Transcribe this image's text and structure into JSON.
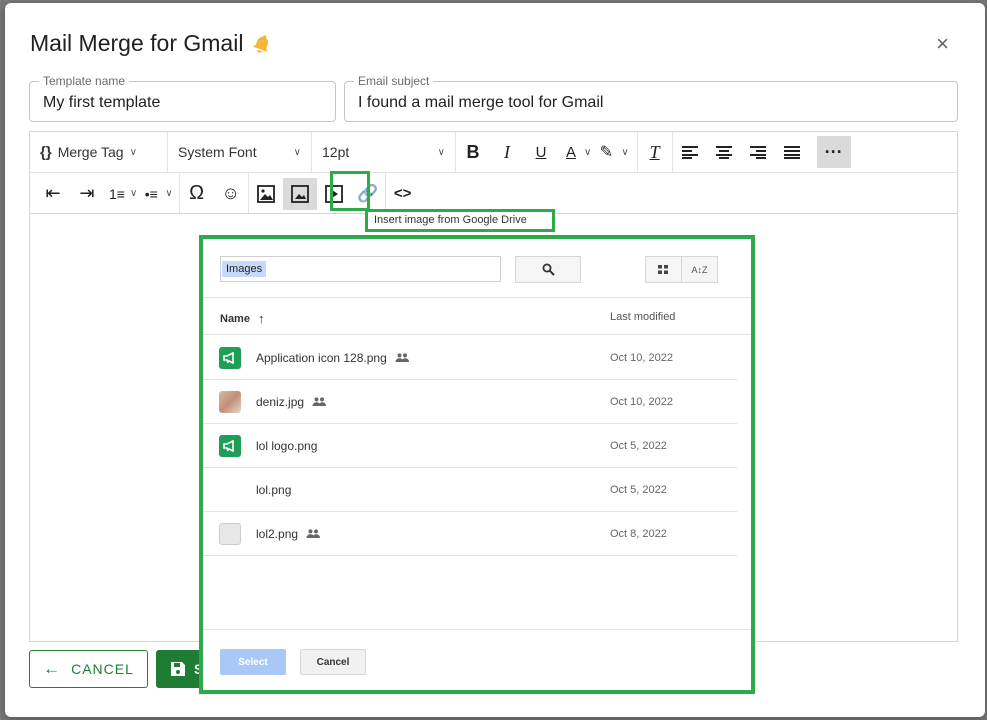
{
  "dialog": {
    "title": "Mail Merge for Gmail",
    "close_symbol": "×"
  },
  "template_name": {
    "label": "Template name",
    "value": "My first template"
  },
  "email_subject": {
    "label": "Email subject",
    "value": "I found a mail merge tool for Gmail"
  },
  "toolbar": {
    "merge_tag_label": "Merge Tag",
    "font_label": "System Font",
    "size_label": "12pt",
    "tooltip": "Insert image from Google Drive",
    "icons": [
      "merge-tag-icon",
      "bold-icon",
      "italic-icon",
      "underline-icon",
      "text-color-icon",
      "highlight-icon",
      "clear-formatting-icon",
      "align-left-icon",
      "align-center-icon",
      "align-right-icon",
      "justify-icon",
      "more-icon",
      "outdent-icon",
      "indent-icon",
      "numbered-list-icon",
      "bullet-list-icon",
      "special-char-icon",
      "emoji-icon",
      "insert-image-icon",
      "drive-image-icon",
      "video-icon",
      "link-icon",
      "code-icon"
    ]
  },
  "buttons": {
    "cancel": "CANCEL",
    "save_partial": "S"
  },
  "picker": {
    "search_value": "Images",
    "column_name": "Name",
    "column_modified": "Last modified",
    "files": [
      {
        "name": "Application icon 128.png",
        "shared": true,
        "date": "Oct 10, 2022",
        "icon": "green"
      },
      {
        "name": "deniz.jpg",
        "shared": true,
        "date": "Oct 10, 2022",
        "icon": "photo"
      },
      {
        "name": "lol logo.png",
        "shared": false,
        "date": "Oct 5, 2022",
        "icon": "green"
      },
      {
        "name": "lol.png",
        "shared": false,
        "date": "Oct 5, 2022",
        "icon": "none"
      },
      {
        "name": "lol2.png",
        "shared": true,
        "date": "Oct 8, 2022",
        "icon": "blank"
      }
    ],
    "select_label": "Select",
    "cancel_label": "Cancel"
  },
  "colors": {
    "highlight_green": "#2eaa4a",
    "save_green": "#1f7c34",
    "select_blue": "#a9c8f7"
  }
}
